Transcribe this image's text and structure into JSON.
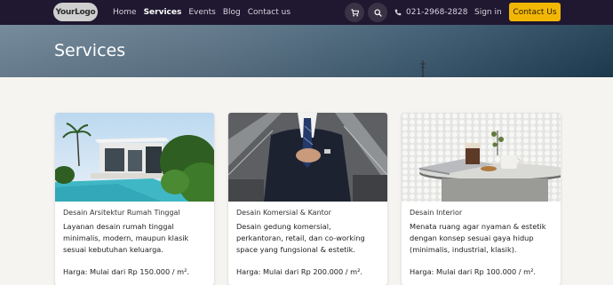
{
  "brand": {
    "logo_text": "YourLogo"
  },
  "nav": {
    "links": [
      "Home",
      "Services",
      "Events",
      "Blog",
      "Contact us"
    ],
    "active": "Services",
    "phone": "021-2968-2828",
    "signin": "Sign in",
    "contact_button": "Contact Us"
  },
  "hero": {
    "title": "Services"
  },
  "cards": [
    {
      "title": "Desain Arsitektur Rumah Tinggal",
      "description": "Layanan desain rumah tinggal minimalis, modern, maupun klasik sesuai kebutuhan keluarga.",
      "price": "Harga: Mulai dari Rp 150.000 / m²."
    },
    {
      "title": "Desain Komersial & Kantor",
      "description": "Desain gedung komersial, perkantoran, retail, dan co-working space yang fungsional & estetik.",
      "price": "Harga: Mulai dari Rp 200.000 / m²."
    },
    {
      "title": "Desain Interior",
      "description": "Menata ruang agar nyaman & estetik dengan konsep sesuai gaya hidup (minimalis, industrial, klasik).",
      "price": "Harga: Mulai dari Rp 100.000 / m²."
    }
  ],
  "colors": {
    "navbar": "#1f1830",
    "accent": "#f2b705",
    "page_bg": "#f6f4f1"
  },
  "icons": {
    "cart": "cart-icon",
    "search": "search-icon",
    "phone": "phone-icon"
  }
}
